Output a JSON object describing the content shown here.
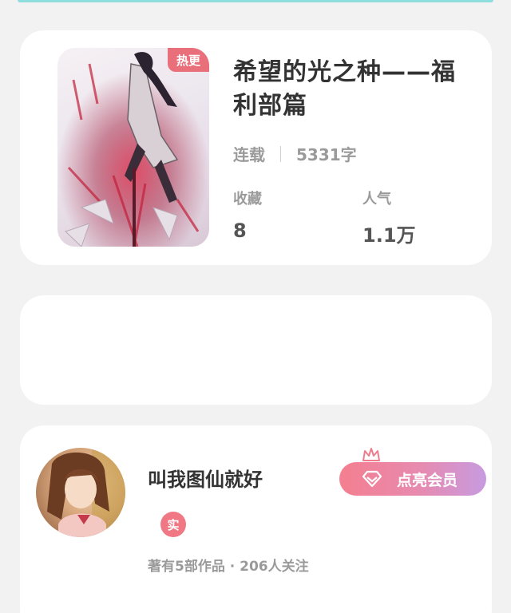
{
  "book": {
    "hot_badge": "热更",
    "title": "希望的光之种——福利部篇",
    "status": "连载",
    "word_count": "5331字",
    "favorites_label": "收藏",
    "favorites_value": "8",
    "popularity_label": "人气",
    "popularity_value": "1.1万"
  },
  "author": {
    "name": "叫我图仙就好",
    "verified_badge": "实",
    "stats": "著有5部作品 · 206人关注",
    "vip_button_label": "点亮会员"
  },
  "colors": {
    "page_bg": "#f2f2f2",
    "card_bg": "#ffffff",
    "hot_badge": "#e96f7a",
    "vip_gradient_start": "#f47f8f",
    "vip_gradient_end": "#c79be0"
  },
  "icons": {
    "vip_button": "diamond-icon",
    "vip_crown": "crown-icon"
  }
}
